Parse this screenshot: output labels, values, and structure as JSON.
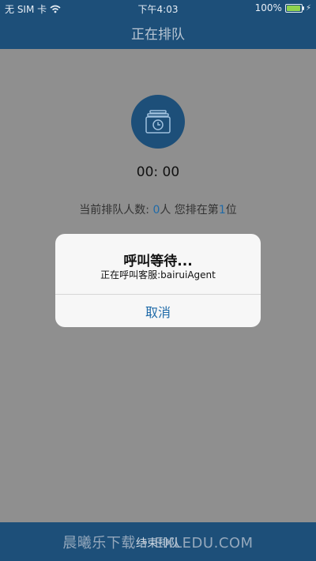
{
  "status_bar": {
    "carrier": "无 SIM 卡",
    "time": "下午4:03",
    "battery": "100%"
  },
  "navbar": {
    "title": "正在排队"
  },
  "main": {
    "timer": "00: 00",
    "queue_prefix": "当前排队人数: ",
    "queue_count": "0",
    "queue_mid": "人 您排在第",
    "position": "1",
    "queue_suffix": "位"
  },
  "alert": {
    "title": "呼叫等待...",
    "message": "正在呼叫客服:bairuiAgent",
    "cancel_label": "取消"
  },
  "bottom": {
    "end_label": "结束排队",
    "watermark": "晨曦乐下载 • EXLEDU.COM"
  },
  "colors": {
    "primary": "#1d4f79",
    "accent": "#1f6aa8",
    "overlay": "#8f8f8f"
  }
}
